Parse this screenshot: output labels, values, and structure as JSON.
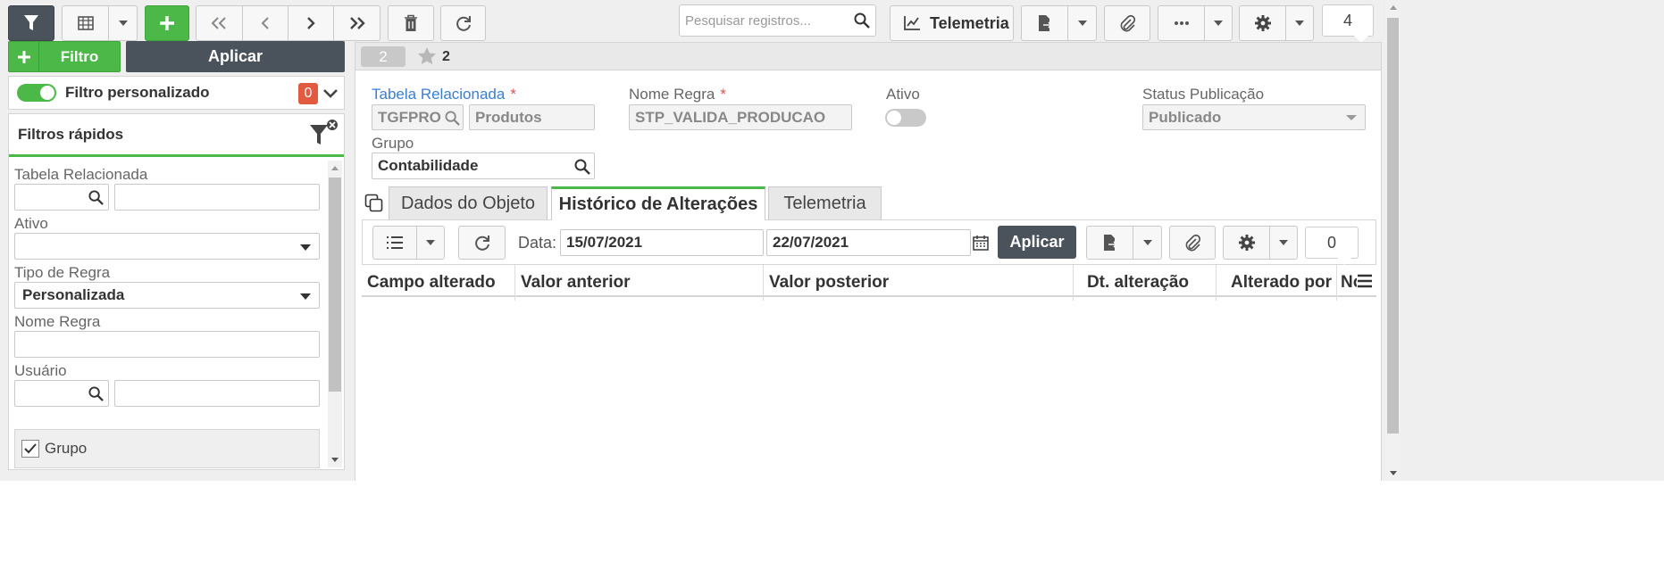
{
  "toolbar": {
    "search_placeholder": "Pesquisar registros...",
    "telemetria_label": "Telemetria",
    "record_count": "4"
  },
  "left": {
    "add_filter_label": "Filtro",
    "apply_label": "Aplicar",
    "custom_filter_label": "Filtro personalizado",
    "custom_filter_count": "0",
    "quick_filters_title": "Filtros rápidos",
    "fields": {
      "tabela_label": "Tabela Relacionada",
      "ativo_label": "Ativo",
      "tipo_label": "Tipo de Regra",
      "tipo_value": "Personalizada",
      "nome_label": "Nome Regra",
      "usuario_label": "Usuário",
      "grupo_label": "Grupo"
    }
  },
  "record": {
    "badge": "2",
    "favorites": "2",
    "tabela_label": "Tabela Relacionada",
    "tabela_code": "TGFPRO",
    "tabela_desc": "Produtos",
    "nome_label": "Nome Regra",
    "nome_value": "STP_VALIDA_PRODUCAO",
    "ativo_label": "Ativo",
    "status_label": "Status Publicação",
    "status_value": "Publicado",
    "grupo_label": "Grupo",
    "grupo_value": "Contabilidade"
  },
  "tabs": [
    "Dados do Objeto",
    "Histórico de Alterações",
    "Telemetria"
  ],
  "history": {
    "date_label": "Data:",
    "date_from": "15/07/2021",
    "date_to": "22/07/2021",
    "apply_label": "Aplicar",
    "count": "0",
    "columns": [
      "Campo alterado",
      "Valor anterior",
      "Valor posterior",
      "Dt. alteração",
      "Alterado por",
      "No"
    ]
  }
}
